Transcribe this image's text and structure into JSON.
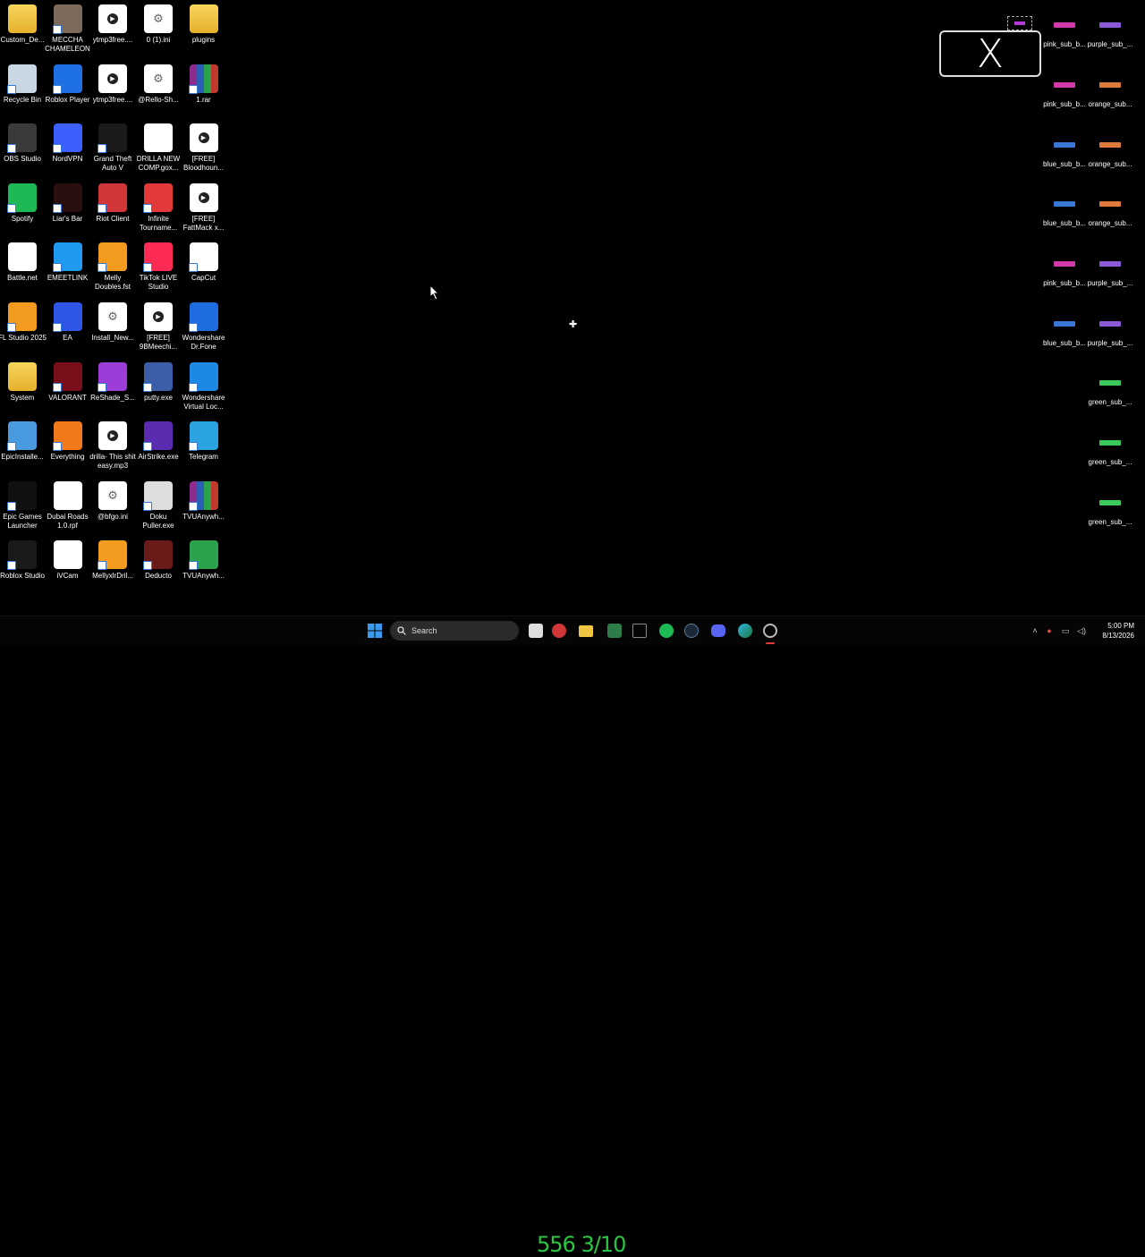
{
  "desktop_icons": [
    {
      "label": "Custom_De...",
      "icon": "folder-icon",
      "kind": "folder",
      "color": "#f0c542"
    },
    {
      "label": "MECCHA CHAMELEON",
      "icon": "game-icon",
      "kind": "app",
      "color": "#7c6a5a"
    },
    {
      "label": "ytmp3free....",
      "icon": "media-file-icon",
      "kind": "media",
      "color": "#ffffff"
    },
    {
      "label": "0 (1).ini",
      "icon": "settings-file-icon",
      "kind": "gear",
      "color": "#ffffff"
    },
    {
      "label": "plugins",
      "icon": "folder-icon",
      "kind": "folder",
      "color": "#f0c542"
    },
    {
      "label": "Recycle Bin",
      "icon": "recycle-bin-icon",
      "kind": "app",
      "color": "#c9d6e3"
    },
    {
      "label": "Roblox Player",
      "icon": "roblox-icon",
      "kind": "app",
      "color": "#1f6fe5"
    },
    {
      "label": "ytmp3free....",
      "icon": "media-file-icon",
      "kind": "media",
      "color": "#ffffff"
    },
    {
      "label": "@Rello-Sh...",
      "icon": "settings-file-icon",
      "kind": "gear",
      "color": "#ffffff"
    },
    {
      "label": "1.rar",
      "icon": "rar-archive-icon",
      "kind": "rar",
      "color": "#8e2b8e"
    },
    {
      "label": "OBS Studio",
      "icon": "obs-icon",
      "kind": "round",
      "color": "#3a3a3a"
    },
    {
      "label": "NordVPN",
      "icon": "nordvpn-icon",
      "kind": "round",
      "color": "#3e5fff"
    },
    {
      "label": "Grand Theft Auto V",
      "icon": "gta-icon",
      "kind": "app",
      "color": "#1a1a1a"
    },
    {
      "label": "DRILLA NEW COMP.gox...",
      "icon": "file-icon",
      "kind": "file",
      "color": "#ffffff"
    },
    {
      "label": "[FREE] Bloodhoun...",
      "icon": "media-file-icon",
      "kind": "media",
      "color": "#ffffff"
    },
    {
      "label": "Spotify",
      "icon": "spotify-icon",
      "kind": "round",
      "color": "#1db954"
    },
    {
      "label": "Liar's Bar",
      "icon": "game-icon",
      "kind": "app",
      "color": "#2a0f0f"
    },
    {
      "label": "Riot Client",
      "icon": "riot-icon",
      "kind": "round",
      "color": "#d13639"
    },
    {
      "label": "Infinite Tourname...",
      "icon": "x-game-icon",
      "kind": "app",
      "color": "#e23a3a"
    },
    {
      "label": "[FREE] FattMack x...",
      "icon": "media-file-icon",
      "kind": "media",
      "color": "#ffffff"
    },
    {
      "label": "Battle.net",
      "icon": "file-icon",
      "kind": "file",
      "color": "#ffffff"
    },
    {
      "label": "EMEETLINK",
      "icon": "emeet-icon",
      "kind": "app",
      "color": "#1e9bf0"
    },
    {
      "label": "Melly Doubles.fst",
      "icon": "fl-studio-icon",
      "kind": "round",
      "color": "#f29b1f"
    },
    {
      "label": "TikTok LIVE Studio",
      "icon": "tiktok-icon",
      "kind": "app",
      "color": "#fe2c55"
    },
    {
      "label": "CapCut",
      "icon": "capcut-icon",
      "kind": "app",
      "color": "#ffffff"
    },
    {
      "label": "FL Studio 2025",
      "icon": "fl-studio-icon",
      "kind": "round",
      "color": "#f29b1f"
    },
    {
      "label": "EA",
      "icon": "ea-icon",
      "kind": "round",
      "color": "#2f55e6"
    },
    {
      "label": "Install_New...",
      "icon": "settings-file-icon",
      "kind": "gear",
      "color": "#ffffff"
    },
    {
      "label": "[FREE] 9BMeechi...",
      "icon": "media-file-icon",
      "kind": "media",
      "color": "#ffffff"
    },
    {
      "label": "Wondershare Dr.Fone",
      "icon": "drfone-icon",
      "kind": "app",
      "color": "#1e6ce0"
    },
    {
      "label": "System",
      "icon": "folder-icon",
      "kind": "folder",
      "color": "#f0c542"
    },
    {
      "label": "VALORANT",
      "icon": "valorant-icon",
      "kind": "app",
      "color": "#7a0f1c"
    },
    {
      "label": "ReShade_S...",
      "icon": "reshade-icon",
      "kind": "round",
      "color": "#9b3dd6"
    },
    {
      "label": "putty.exe",
      "icon": "putty-icon",
      "kind": "app",
      "color": "#3a5fa8"
    },
    {
      "label": "Wondershare Virtual Loc...",
      "icon": "location-icon",
      "kind": "app",
      "color": "#1e88e5"
    },
    {
      "label": "EpicInstalle...",
      "icon": "installer-icon",
      "kind": "app",
      "color": "#4a9adf"
    },
    {
      "label": "Everything",
      "icon": "search-magnifier-icon",
      "kind": "round",
      "color": "#f07a1a"
    },
    {
      "label": "drilla- This shit easy.mp3",
      "icon": "media-file-icon",
      "kind": "media",
      "color": "#ffffff"
    },
    {
      "label": "AirStrike.exe",
      "icon": "airstrike-icon",
      "kind": "app",
      "color": "#5b2bb0"
    },
    {
      "label": "Telegram",
      "icon": "telegram-icon",
      "kind": "round",
      "color": "#2aa3e0"
    },
    {
      "label": "Epic Games Launcher",
      "icon": "epic-icon",
      "kind": "app",
      "color": "#111111"
    },
    {
      "label": "Dubai Roads 1.0.rpf",
      "icon": "file-icon",
      "kind": "file",
      "color": "#ffffff"
    },
    {
      "label": "@bfgo.ini",
      "icon": "settings-file-icon",
      "kind": "gear",
      "color": "#ffffff"
    },
    {
      "label": "Doku Puller.exe",
      "icon": "doku-icon",
      "kind": "app",
      "color": "#dddddd"
    },
    {
      "label": "TVUAnywh...",
      "icon": "rar-archive-icon",
      "kind": "rar",
      "color": "#8e2b8e"
    },
    {
      "label": "Roblox Studio",
      "icon": "roblox-studio-icon",
      "kind": "app",
      "color": "#1a1a1a"
    },
    {
      "label": "iVCam",
      "icon": "file-icon",
      "kind": "file",
      "color": "#ffffff"
    },
    {
      "label": "MellyxlrDril...",
      "icon": "fl-studio-icon",
      "kind": "round",
      "color": "#f29b1f"
    },
    {
      "label": "Deducto",
      "icon": "game-icon",
      "kind": "app",
      "color": "#6b1a1a"
    },
    {
      "label": "TVUAnywh...",
      "icon": "tvu-icon",
      "kind": "round",
      "color": "#2aa34c"
    }
  ],
  "weapon_icons": [
    {
      "label": "pink_sub_b...",
      "color": "#d13aa8"
    },
    {
      "label": "purple_sub_...",
      "color": "#8c5ad8"
    },
    {
      "label": "pink_sub_b...",
      "color": "#d13aa8"
    },
    {
      "label": "orange_sub...",
      "color": "#e07a3a"
    },
    {
      "label": "blue_sub_b...",
      "color": "#3a78d8"
    },
    {
      "label": "orange_sub...",
      "color": "#e07a3a"
    },
    {
      "label": "blue_sub_b...",
      "color": "#3a78d8"
    },
    {
      "label": "orange_sub...",
      "color": "#e07a3a"
    },
    {
      "label": "pink_sub_b...",
      "color": "#d13aa8"
    },
    {
      "label": "purple_sub_...",
      "color": "#8c5ad8"
    },
    {
      "label": "blue_sub_b...",
      "color": "#3a78d8"
    },
    {
      "label": "purple_sub_...",
      "color": "#8c5ad8"
    },
    {
      "label": "green_sub_...",
      "color": "#3ac95a"
    },
    {
      "label": "green_sub_...",
      "color": "#3ac95a"
    },
    {
      "label": "green_sub_...",
      "color": "#3ac95a"
    }
  ],
  "x_logo": {
    "glyph": "X"
  },
  "taskbar": {
    "search_label": "Search",
    "overlay_counter": "556 3/10",
    "clock_time": "5:00 PM",
    "clock_date": "8/13/2026"
  }
}
